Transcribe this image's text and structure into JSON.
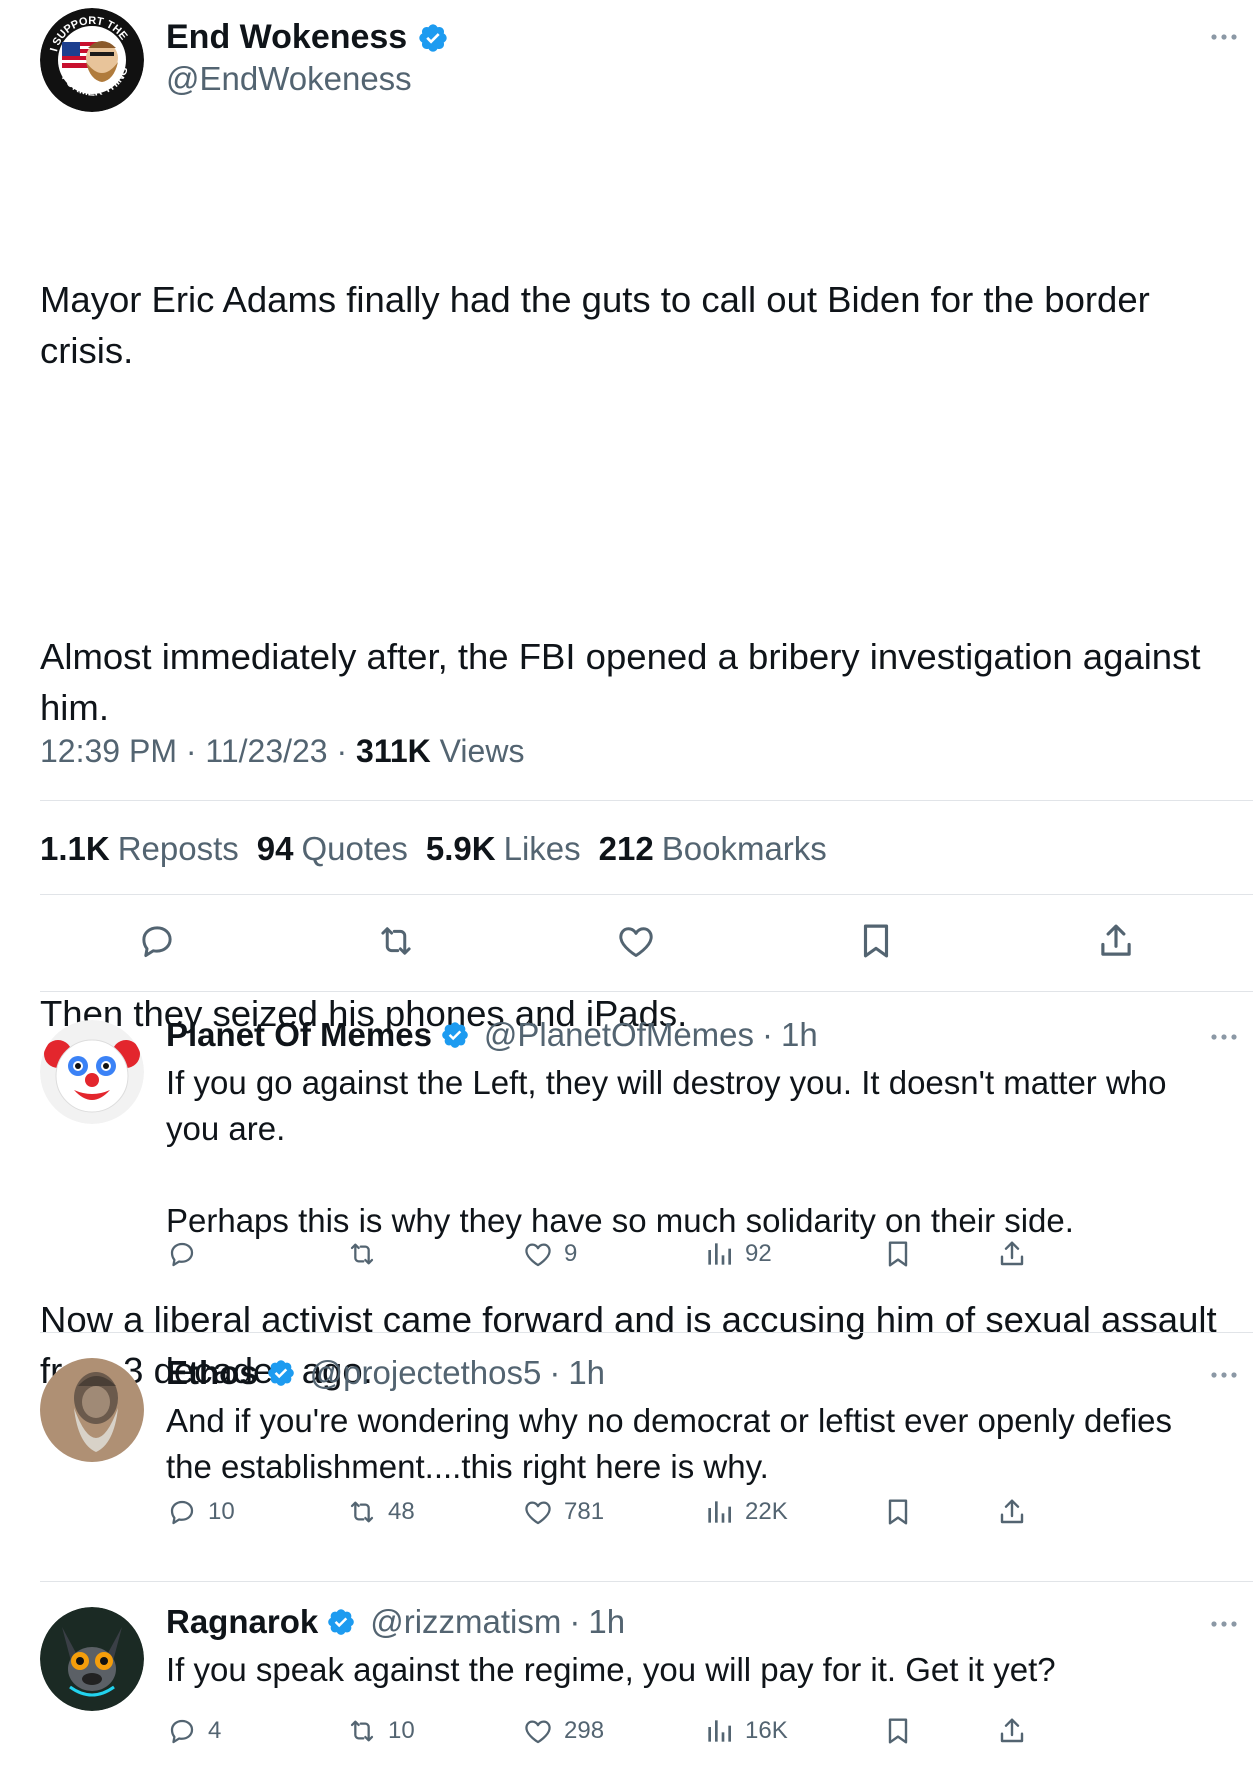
{
  "colors": {
    "verified": "#1d9bf0",
    "text": "#0f1419",
    "muted": "#536471",
    "divider": "#e1e4e8"
  },
  "main_tweet": {
    "avatar": {
      "icon": "support-former-thing-logo",
      "ring_text_top": "I SUPPORT THE",
      "ring_text_bottom": "FORMER THING"
    },
    "display_name": "End Wokeness",
    "handle": "@EndWokeness",
    "paragraphs": [
      "Mayor Eric Adams finally had the guts to call out Biden for the border crisis.",
      "Almost immediately after, the FBI opened a bribery investigation against him.",
      "Then they seized his phones and iPads.",
      "Now a liberal activist came forward and is accusing him of sexual assault from 3 decades ago."
    ],
    "time": "12:39 PM",
    "date": "11/23/23",
    "views_count": "311K",
    "views_label": "Views",
    "stats": [
      {
        "count": "1.1K",
        "label": "Reposts"
      },
      {
        "count": "94",
        "label": "Quotes"
      },
      {
        "count": "5.9K",
        "label": "Likes"
      },
      {
        "count": "212",
        "label": "Bookmarks"
      }
    ],
    "actions": [
      "reply-icon",
      "repost-icon",
      "like-icon",
      "bookmark-icon",
      "share-icon"
    ]
  },
  "replies": [
    {
      "display_name": "Planet Of Memes",
      "handle": "@PlanetOfMemes",
      "sep": "·",
      "time": "1h",
      "avatar_icon": "clown-face-icon",
      "text": "If you go against the Left, they will destroy you. It doesn't matter who you are.\n\nPerhaps this is why they have so much solidarity on their side.",
      "replies": "",
      "reposts": "",
      "likes": "9",
      "views": "92"
    },
    {
      "display_name": "Ethos",
      "handle": "@projectethos5",
      "sep": "·",
      "time": "1h",
      "avatar_icon": "philosopher-statue-icon",
      "text": "And if you're wondering why no democrat or leftist ever openly defies the establishment....this right here is why.",
      "replies": "10",
      "reposts": "48",
      "likes": "781",
      "views": "22K"
    },
    {
      "display_name": "Ragnarok",
      "handle": "@rizzmatism",
      "sep": "·",
      "time": "1h",
      "avatar_icon": "cyber-bulldog-icon",
      "text": "If you speak against the regime, you will pay for it. Get it yet?",
      "replies": "4",
      "reposts": "10",
      "likes": "298",
      "views": "16K"
    }
  ]
}
